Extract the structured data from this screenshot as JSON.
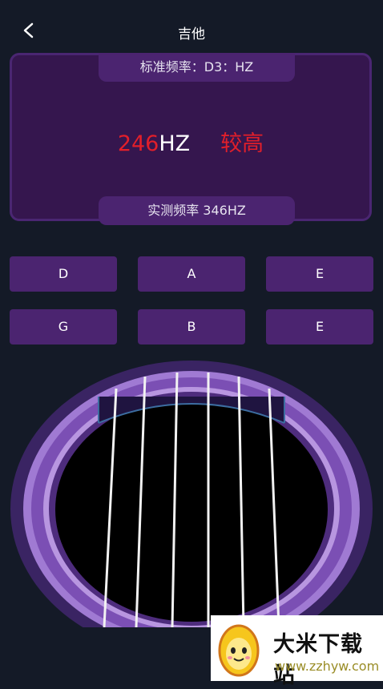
{
  "header": {
    "title": "吉他"
  },
  "reading": {
    "standard_frequency": "标准频率：D3：HZ",
    "current_value": "246",
    "current_unit": "HZ",
    "status": "较高",
    "measured_frequency": "实测频率    346HZ"
  },
  "notes": [
    "D",
    "A",
    "E",
    "G",
    "B",
    "E"
  ],
  "watermark": {
    "name": "大米下载站",
    "url": "www.zzhyw.com"
  },
  "colors": {
    "background": "#141a27",
    "panel": "#35164e",
    "button": "#4b2470",
    "alert": "#e21f2a"
  }
}
